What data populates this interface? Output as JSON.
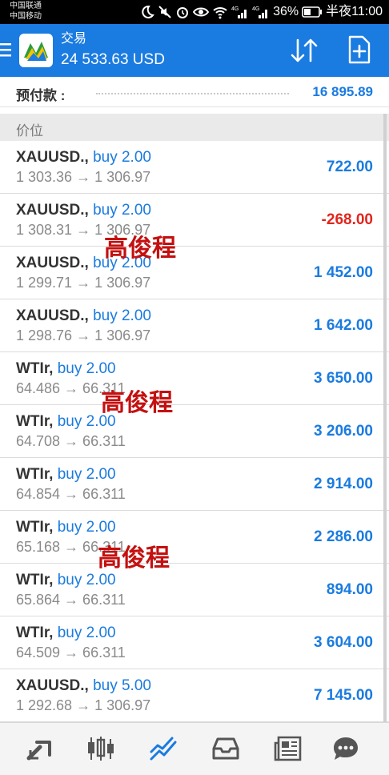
{
  "status_bar": {
    "carrier1": "中国联通",
    "carrier2": "中国移动",
    "battery_percent": "36%",
    "time": "半夜11:00",
    "network1": "4G",
    "network2": "4G"
  },
  "app_bar": {
    "title": "交易",
    "balance": "24 533.63 USD",
    "icons": [
      "menu-icon",
      "metatrader-logo",
      "sort-icon",
      "new-order-icon"
    ]
  },
  "deposit": {
    "label": "预付款 :",
    "value": "16 895.89"
  },
  "section": {
    "title": "价位"
  },
  "positions": [
    {
      "symbol": "XAUUSD.,",
      "side": "buy 2.00",
      "prices": "1 303.36 → 1 306.97",
      "profit": "722.00",
      "negative": false
    },
    {
      "symbol": "XAUUSD.,",
      "side": "buy 2.00",
      "prices": "1 308.31 → 1 306.97",
      "profit": "-268.00",
      "negative": true
    },
    {
      "symbol": "XAUUSD.,",
      "side": "buy 2.00",
      "prices": "1 299.71 → 1 306.97",
      "profit": "1 452.00",
      "negative": false
    },
    {
      "symbol": "XAUUSD.,",
      "side": "buy 2.00",
      "prices": "1 298.76 → 1 306.97",
      "profit": "1 642.00",
      "negative": false
    },
    {
      "symbol": "WTIr,",
      "side": "buy 2.00",
      "prices": "64.486 → 66.311",
      "profit": "3 650.00",
      "negative": false
    },
    {
      "symbol": "WTIr,",
      "side": "buy 2.00",
      "prices": "64.708 → 66.311",
      "profit": "3 206.00",
      "negative": false
    },
    {
      "symbol": "WTIr,",
      "side": "buy 2.00",
      "prices": "64.854 → 66.311",
      "profit": "2 914.00",
      "negative": false
    },
    {
      "symbol": "WTIr,",
      "side": "buy 2.00",
      "prices": "65.168 → 66.311",
      "profit": "2 286.00",
      "negative": false
    },
    {
      "symbol": "WTIr,",
      "side": "buy 2.00",
      "prices": "65.864 → 66.311",
      "profit": "894.00",
      "negative": false
    },
    {
      "symbol": "WTIr,",
      "side": "buy 2.00",
      "prices": "64.509 → 66.311",
      "profit": "3 604.00",
      "negative": false
    },
    {
      "symbol": "XAUUSD.,",
      "side": "buy 5.00",
      "prices": "1 292.68 → 1 306.97",
      "profit": "7 145.00",
      "negative": false
    }
  ],
  "watermark": {
    "text": "高俊程",
    "color": "#c41010"
  },
  "bottom_nav": [
    {
      "name": "quotes-icon",
      "active": false
    },
    {
      "name": "chart-icon",
      "active": false
    },
    {
      "name": "trade-icon",
      "active": true
    },
    {
      "name": "history-icon",
      "active": false
    },
    {
      "name": "news-icon",
      "active": false
    },
    {
      "name": "chat-icon",
      "active": false
    }
  ],
  "colors": {
    "accent": "#1a7be0",
    "negative": "#e0261d",
    "app_bar": "#1a7be0"
  }
}
